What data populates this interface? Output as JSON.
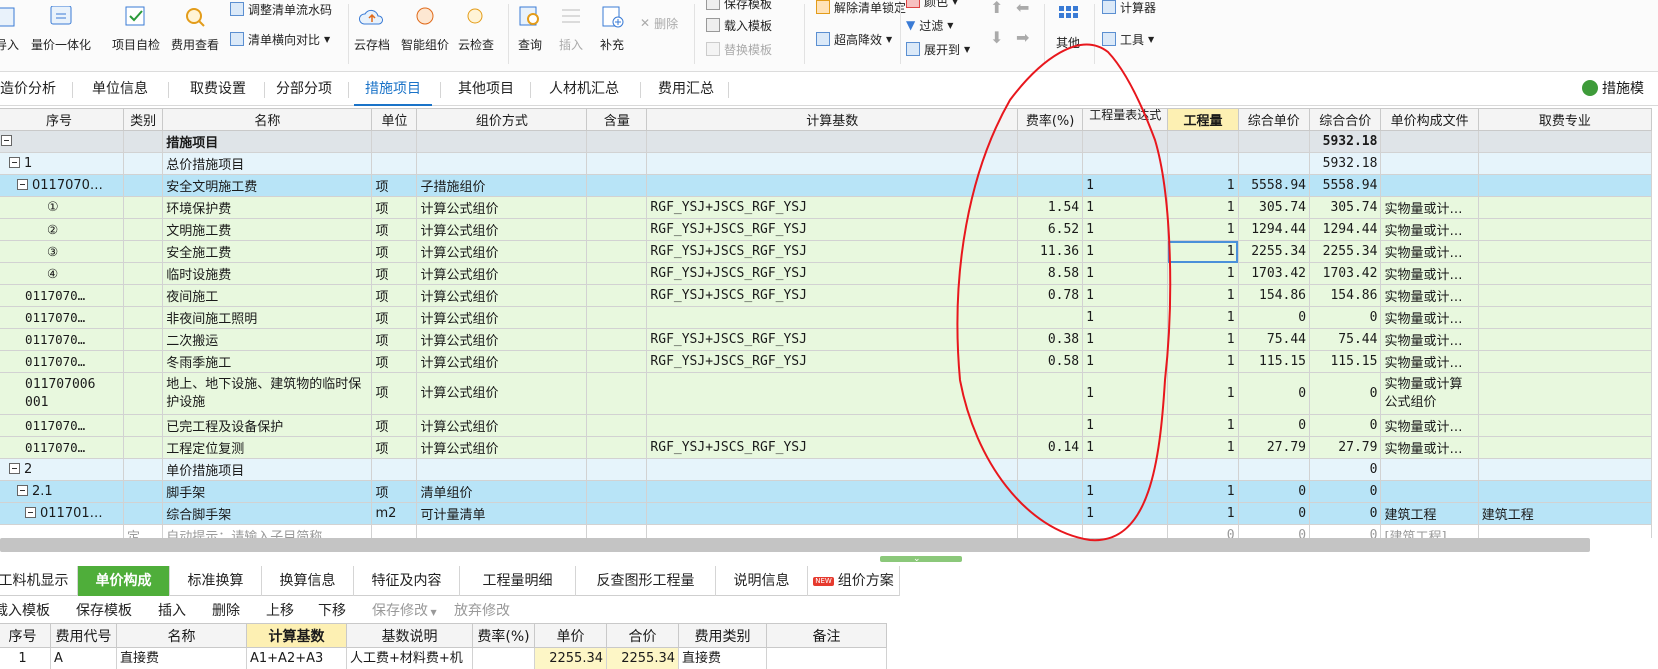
{
  "toolbar": {
    "import_label": "导入",
    "quote_label": "量价一体化",
    "adjust_serial_label": "调整清单流水码",
    "clear_dir_label": "清单横向对比",
    "self_check_label": "项目自检",
    "fee_view_label": "费用查看",
    "cloud_save_label": "云存档",
    "smart_price_label": "智能组价",
    "cloud_check_label": "云检查",
    "query_label": "查询",
    "insert_label": "插入",
    "supplement_label": "补充",
    "delete_label": "删除",
    "save_template_label": "保存模板",
    "load_template_label": "载入模板",
    "replace_template_label": "替换模板",
    "unlock_label": "解除清单锁定",
    "height_reduce_label": "超高降效",
    "color_label": "颜色",
    "filter_label": "过滤",
    "expand_label": "展开到",
    "other_label": "其他",
    "calculator_label": "计算器",
    "tools_label": "工具"
  },
  "tabs": [
    "造价分析",
    "单位信息",
    "取费设置",
    "分部分项",
    "措施项目",
    "其他项目",
    "人材机汇总",
    "费用汇总"
  ],
  "active_tab": "措施项目",
  "right_tab_label": "措施模",
  "grid": {
    "headers": [
      "序号",
      "类别",
      "名称",
      "单位",
      "组价方式",
      "含量",
      "计算基数",
      "费率(%)",
      "工程量表达式",
      "工程量",
      "综合单价",
      "综合合价",
      "单价构成文件",
      "取费专业"
    ],
    "rows": [
      {
        "seq": "",
        "type": "",
        "name": "措施项目",
        "unit": "",
        "method": "",
        "content": "",
        "base": "",
        "rate": "",
        "expr": "",
        "qty": "",
        "unit_price": "",
        "total": "5932.18",
        "file": "",
        "spec": ""
      },
      {
        "seq": "1",
        "type": "",
        "name": "总价措施项目",
        "unit": "",
        "method": "",
        "content": "",
        "base": "",
        "rate": "",
        "expr": "",
        "qty": "",
        "unit_price": "",
        "total": "5932.18",
        "file": "",
        "spec": ""
      },
      {
        "seq": "0117070…",
        "type": "",
        "name": "安全文明施工费",
        "unit": "项",
        "method": "子措施组价",
        "content": "",
        "base": "",
        "rate": "",
        "expr": "1",
        "qty": "1",
        "unit_price": "5558.94",
        "total": "5558.94",
        "file": "",
        "spec": ""
      },
      {
        "seq": "①",
        "type": "",
        "name": "环境保护费",
        "unit": "项",
        "method": "计算公式组价",
        "content": "",
        "base": "RGF_YSJ+JSCS_RGF_YSJ",
        "rate": "1.54",
        "expr": "1",
        "qty": "1",
        "unit_price": "305.74",
        "total": "305.74",
        "file": "实物量或计…",
        "spec": ""
      },
      {
        "seq": "②",
        "type": "",
        "name": "文明施工费",
        "unit": "项",
        "method": "计算公式组价",
        "content": "",
        "base": "RGF_YSJ+JSCS_RGF_YSJ",
        "rate": "6.52",
        "expr": "1",
        "qty": "1",
        "unit_price": "1294.44",
        "total": "1294.44",
        "file": "实物量或计…",
        "spec": ""
      },
      {
        "seq": "③",
        "type": "",
        "name": "安全施工费",
        "unit": "项",
        "method": "计算公式组价",
        "content": "",
        "base": "RGF_YSJ+JSCS_RGF_YSJ",
        "rate": "11.36",
        "expr": "1",
        "qty": "1",
        "unit_price": "2255.34",
        "total": "2255.34",
        "file": "实物量或计…",
        "spec": ""
      },
      {
        "seq": "④",
        "type": "",
        "name": "临时设施费",
        "unit": "项",
        "method": "计算公式组价",
        "content": "",
        "base": "RGF_YSJ+JSCS_RGF_YSJ",
        "rate": "8.58",
        "expr": "1",
        "qty": "1",
        "unit_price": "1703.42",
        "total": "1703.42",
        "file": "实物量或计…",
        "spec": ""
      },
      {
        "seq": "0117070…",
        "type": "",
        "name": "夜间施工",
        "unit": "项",
        "method": "计算公式组价",
        "content": "",
        "base": "RGF_YSJ+JSCS_RGF_YSJ",
        "rate": "0.78",
        "expr": "1",
        "qty": "1",
        "unit_price": "154.86",
        "total": "154.86",
        "file": "实物量或计…",
        "spec": ""
      },
      {
        "seq": "0117070…",
        "type": "",
        "name": "非夜间施工照明",
        "unit": "项",
        "method": "计算公式组价",
        "content": "",
        "base": "",
        "rate": "",
        "expr": "1",
        "qty": "1",
        "unit_price": "0",
        "total": "0",
        "file": "实物量或计…",
        "spec": ""
      },
      {
        "seq": "0117070…",
        "type": "",
        "name": "二次搬运",
        "unit": "项",
        "method": "计算公式组价",
        "content": "",
        "base": "RGF_YSJ+JSCS_RGF_YSJ",
        "rate": "0.38",
        "expr": "1",
        "qty": "1",
        "unit_price": "75.44",
        "total": "75.44",
        "file": "实物量或计…",
        "spec": ""
      },
      {
        "seq": "0117070…",
        "type": "",
        "name": "冬雨季施工",
        "unit": "项",
        "method": "计算公式组价",
        "content": "",
        "base": "RGF_YSJ+JSCS_RGF_YSJ",
        "rate": "0.58",
        "expr": "1",
        "qty": "1",
        "unit_price": "115.15",
        "total": "115.15",
        "file": "实物量或计…",
        "spec": ""
      },
      {
        "seq": "011707006 001",
        "type": "",
        "name": "地上、地下设施、建筑物的临时保护设施",
        "unit": "项",
        "method": "计算公式组价",
        "content": "",
        "base": "",
        "rate": "",
        "expr": "1",
        "qty": "1",
        "unit_price": "0",
        "total": "0",
        "file": "实物量或计算公式组价",
        "spec": ""
      },
      {
        "seq": "0117070…",
        "type": "",
        "name": "已完工程及设备保护",
        "unit": "项",
        "method": "计算公式组价",
        "content": "",
        "base": "",
        "rate": "",
        "expr": "1",
        "qty": "1",
        "unit_price": "0",
        "total": "0",
        "file": "实物量或计…",
        "spec": ""
      },
      {
        "seq": "0117070…",
        "type": "",
        "name": "工程定位复测",
        "unit": "项",
        "method": "计算公式组价",
        "content": "",
        "base": "RGF_YSJ+JSCS_RGF_YSJ",
        "rate": "0.14",
        "expr": "1",
        "qty": "1",
        "unit_price": "27.79",
        "total": "27.79",
        "file": "实物量或计…",
        "spec": ""
      },
      {
        "seq": "2",
        "type": "",
        "name": "单价措施项目",
        "unit": "",
        "method": "",
        "content": "",
        "base": "",
        "rate": "",
        "expr": "",
        "qty": "",
        "unit_price": "",
        "total": "0",
        "file": "",
        "spec": ""
      },
      {
        "seq": "2.1",
        "type": "",
        "name": "脚手架",
        "unit": "项",
        "method": "清单组价",
        "content": "",
        "base": "",
        "rate": "",
        "expr": "1",
        "qty": "1",
        "unit_price": "0",
        "total": "0",
        "file": "",
        "spec": ""
      },
      {
        "seq": "011701…",
        "type": "",
        "name": "综合脚手架",
        "unit": "m2",
        "method": "可计量清单",
        "content": "",
        "base": "",
        "rate": "",
        "expr": "1",
        "qty": "1",
        "unit_price": "0",
        "total": "0",
        "file": "建筑工程",
        "spec": "建筑工程"
      },
      {
        "seq": "",
        "type": "定",
        "name": "自动提示：请输入子目简称",
        "unit": "",
        "method": "",
        "content": "",
        "base": "",
        "rate": "",
        "expr": "",
        "qty": "0",
        "unit_price": "0",
        "total": "0",
        "file": "[建筑工程]",
        "spec": ""
      }
    ]
  },
  "bottom_tabs": [
    "工料机显示",
    "单价构成",
    "标准换算",
    "换算信息",
    "特征及内容",
    "工程量明细",
    "反查图形工程量",
    "说明信息",
    "组价方案"
  ],
  "bottom_active": "单价构成",
  "new_badge": "NEW",
  "bottom_actions": [
    "载入模板",
    "保存模板",
    "插入",
    "删除",
    "上移",
    "下移",
    "保存修改",
    "放弃修改"
  ],
  "sub_grid": {
    "headers": [
      "序号",
      "费用代号",
      "名称",
      "计算基数",
      "基数说明",
      "费率(%)",
      "单价",
      "合价",
      "费用类别",
      "备注"
    ],
    "row": {
      "seq": "1",
      "code": "A",
      "name": "直接费",
      "base": "A1+A2+A3",
      "desc": "人工费+材料费+机",
      "rate": "",
      "price": "2255.34",
      "total": "2255.34",
      "category": "直接费",
      "note": ""
    }
  },
  "colors": {
    "accent": "#1a73c8",
    "green_tab": "#4fae3a",
    "annotation": "#e8171d"
  }
}
